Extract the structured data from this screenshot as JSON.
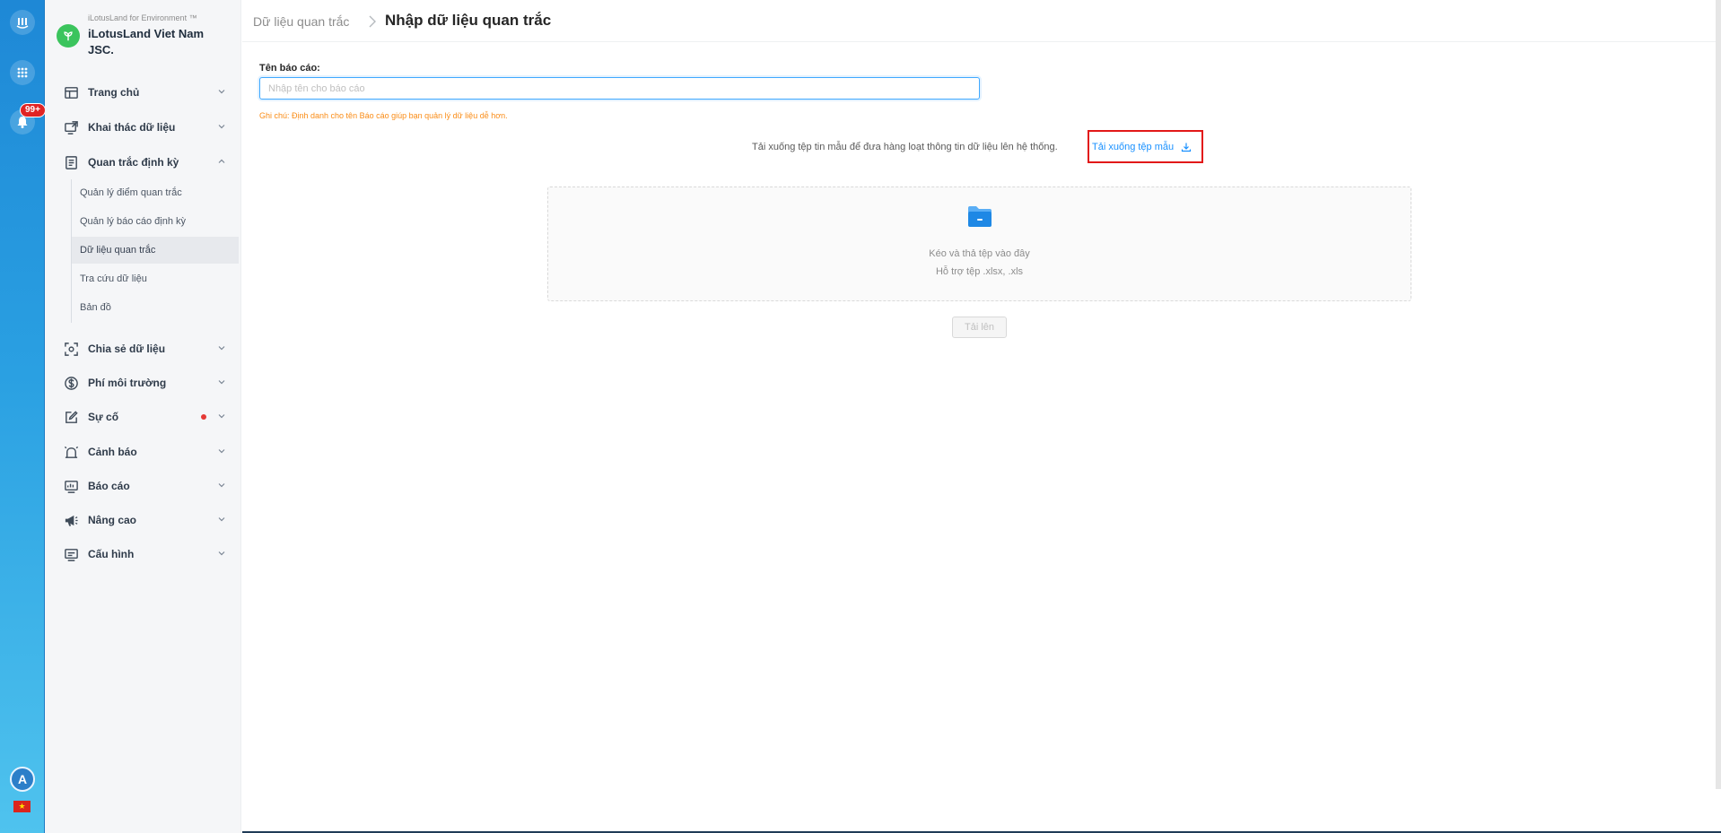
{
  "rail": {
    "notification_badge": "99+",
    "avatar_letter": "A",
    "flag_glyph": "★",
    "icons": [
      "app-logo-icon",
      "apps-grid-icon",
      "bell-icon"
    ]
  },
  "brand": {
    "subtitle": "iLotusLand for Environment ™",
    "name": "iLotusLand Viet Nam JSC."
  },
  "menu": {
    "items": [
      {
        "label": "Trang chủ",
        "icon": "home-layout-icon"
      },
      {
        "label": "Khai thác dữ liệu",
        "icon": "monitor-share-icon"
      },
      {
        "label": "Quan trắc định kỳ",
        "icon": "document-list-icon"
      },
      {
        "label": "Chia sẻ dữ liệu",
        "icon": "share-frame-icon"
      },
      {
        "label": "Phí môi trường",
        "icon": "dollar-circle-icon"
      },
      {
        "label": "Sự cố",
        "icon": "edit-note-icon"
      },
      {
        "label": "Cảnh báo",
        "icon": "alarm-bell-icon"
      },
      {
        "label": "Báo cáo",
        "icon": "report-screen-icon"
      },
      {
        "label": "Nâng cao",
        "icon": "megaphone-icon"
      },
      {
        "label": "Cấu hình",
        "icon": "config-screen-icon"
      }
    ],
    "submenu": [
      "Quản lý điểm quan trắc",
      "Quản lý báo cáo định kỳ",
      "Dữ liệu quan trắc",
      "Tra cứu dữ liệu",
      "Bản đồ"
    ],
    "active_submenu": "Dữ liệu quan trắc"
  },
  "header": {
    "breadcrumb_prev": "Dữ liệu quan trắc",
    "title": "Nhập dữ liệu quan trắc"
  },
  "form": {
    "label": "Tên báo cáo:",
    "placeholder": "Nhập tên cho báo cáo",
    "value": "",
    "note": "Ghi chú: Định danh cho tên Báo cáo giúp bạn quản lý dữ liệu dễ hơn."
  },
  "download": {
    "text": "Tải xuống tệp tin mẫu để đưa hàng loạt thông tin dữ liệu lên hệ thống.",
    "link_label": "Tải xuống tệp mẫu"
  },
  "dropzone": {
    "line1": "Kéo và thả tệp vào đây",
    "line2": "Hỗ trợ tệp .xlsx, .xls"
  },
  "upload_button": "Tải lên",
  "colors": {
    "accent": "#1890ff",
    "brand_green": "#3bc45d",
    "note_orange": "#fa8c16",
    "highlight_red": "#e21818",
    "rail_top": "#1e88d6",
    "rail_bottom": "#4fc3ee"
  }
}
